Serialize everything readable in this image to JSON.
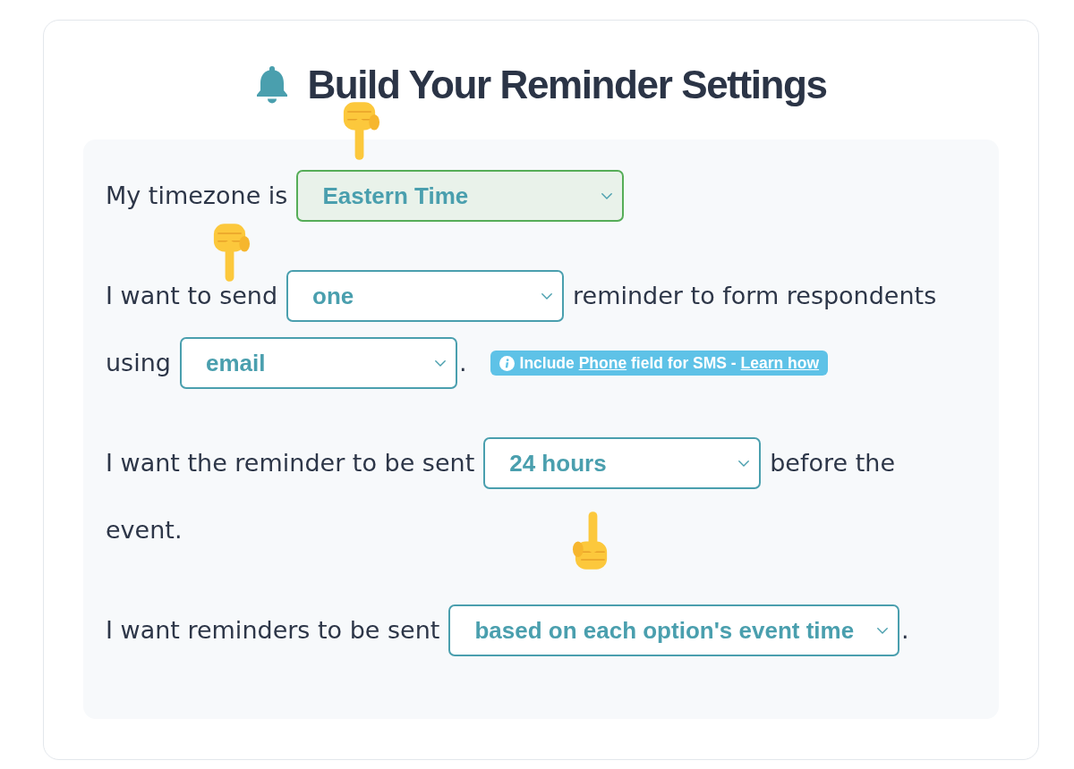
{
  "header": {
    "title": "Build Your Reminder Settings"
  },
  "sentences": [
    {
      "parts": [
        {
          "kind": "text",
          "text": "My timezone is"
        },
        {
          "kind": "dropdown",
          "value": "Eastern Time",
          "highlighted": true
        }
      ]
    },
    {
      "parts": [
        {
          "kind": "text",
          "text": "I want to send"
        },
        {
          "kind": "dropdown",
          "value": "one",
          "highlighted": false
        },
        {
          "kind": "text",
          "text": "reminder to form respondents"
        },
        {
          "kind": "text",
          "text": "using"
        },
        {
          "kind": "dropdown",
          "value": "email",
          "highlighted": false
        },
        {
          "kind": "punct",
          "text": "."
        },
        {
          "kind": "hint",
          "segments": [
            {
              "kind": "text",
              "text": "Include"
            },
            {
              "kind": "link",
              "text": "Phone"
            },
            {
              "kind": "text",
              "text": "field for SMS -"
            },
            {
              "kind": "link",
              "text": "Learn how"
            }
          ]
        }
      ]
    },
    {
      "parts": [
        {
          "kind": "text",
          "text": "I want the reminder to be sent"
        },
        {
          "kind": "dropdown",
          "value": "24 hours",
          "highlighted": false
        },
        {
          "kind": "text",
          "text": "before the"
        },
        {
          "kind": "text",
          "text": "event."
        }
      ]
    },
    {
      "parts": [
        {
          "kind": "text",
          "text": "I want reminders to be sent"
        },
        {
          "kind": "dropdown",
          "value": "based on each option's event time",
          "highlighted": false
        },
        {
          "kind": "punct",
          "text": "."
        }
      ]
    }
  ]
}
